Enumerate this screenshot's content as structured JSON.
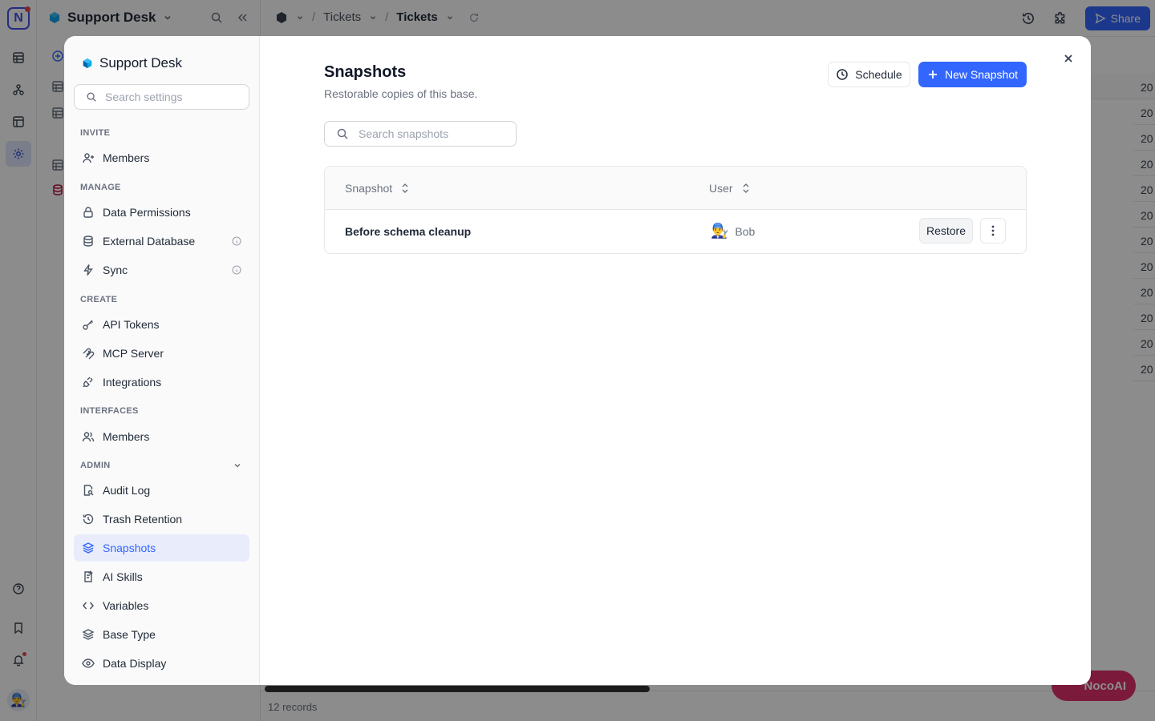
{
  "app": {
    "workspace_name": "Support Desk",
    "breadcrumb": [
      "Tickets",
      "Tickets"
    ],
    "share_label": "Share",
    "records_count": "12 records",
    "noco_ai_label": "NocoAI",
    "grid_year_stub": "20"
  },
  "settings": {
    "title": "Support Desk",
    "search_placeholder": "Search settings",
    "sections": {
      "invite": "INVITE",
      "manage": "MANAGE",
      "create": "CREATE",
      "interfaces": "INTERFACES",
      "admin": "ADMIN"
    },
    "items": {
      "members": "Members",
      "data_permissions": "Data Permissions",
      "external_database": "External Database",
      "sync": "Sync",
      "api_tokens": "API Tokens",
      "mcp_server": "MCP Server",
      "integrations": "Integrations",
      "interfaces_members": "Members",
      "audit_log": "Audit Log",
      "trash_retention": "Trash Retention",
      "snapshots": "Snapshots",
      "ai_skills": "AI Skills",
      "variables": "Variables",
      "base_type": "Base Type",
      "data_display": "Data Display"
    },
    "active_item": "snapshots"
  },
  "snapshots": {
    "title": "Snapshots",
    "subtitle": "Restorable copies of this base.",
    "schedule_label": "Schedule",
    "new_label": "New Snapshot",
    "search_placeholder": "Search snapshots",
    "columns": {
      "snapshot": "Snapshot",
      "user": "User"
    },
    "rows": [
      {
        "name": "Before schema cleanup",
        "user": "Bob",
        "avatar": "👨‍🔧",
        "restore_label": "Restore"
      }
    ]
  },
  "colors": {
    "accent": "#3366ff",
    "active_bg": "#e8ecfb",
    "danger": "#e1306c"
  }
}
